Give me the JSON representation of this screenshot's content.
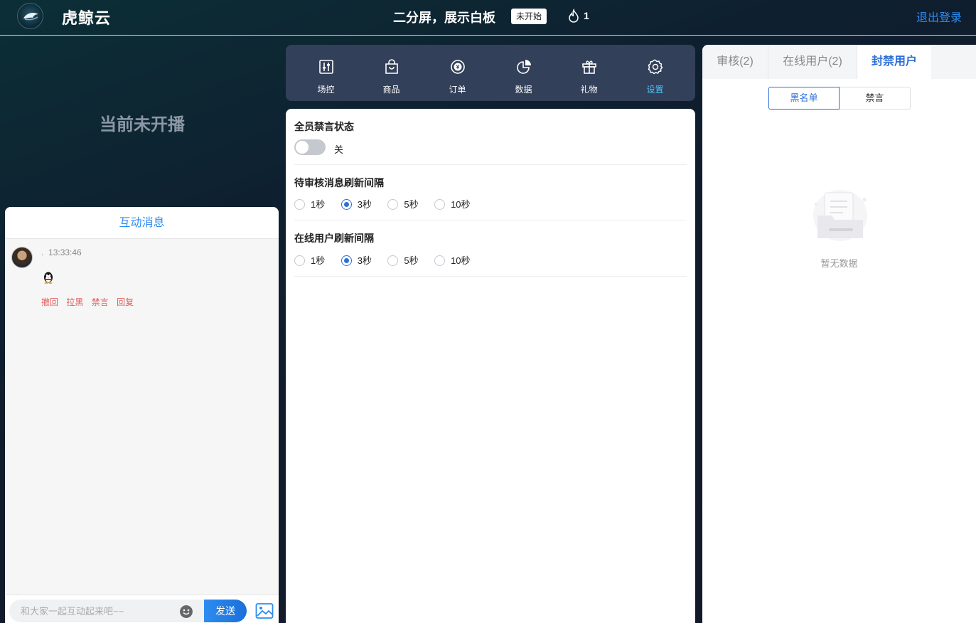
{
  "header": {
    "brand": "虎鲸云",
    "title": "二分屏，展示白板",
    "status": "未开始",
    "viewers": "1",
    "logout": "退出登录"
  },
  "stage": {
    "no_live_text": "当前未开播"
  },
  "chat": {
    "title": "互动消息",
    "messages": [
      {
        "user": ".",
        "time": "13:33:46",
        "content_icon": "penguin-emoji",
        "actions": [
          "撤回",
          "拉黑",
          "禁言",
          "回复"
        ]
      }
    ],
    "input_placeholder": "和大家一起互动起来吧~~",
    "send_label": "发送"
  },
  "toolbar": {
    "items": [
      {
        "label": "场控",
        "icon": "field-control-icon"
      },
      {
        "label": "商品",
        "icon": "shopping-bag-icon"
      },
      {
        "label": "订单",
        "icon": "yuan-coin-icon"
      },
      {
        "label": "数据",
        "icon": "pie-chart-icon"
      },
      {
        "label": "礼物",
        "icon": "gift-icon"
      },
      {
        "label": "设置",
        "icon": "gear-icon",
        "active": true
      }
    ],
    "active_color": "#4fc3f7"
  },
  "settings": {
    "mute_all": {
      "title": "全员禁言状态",
      "state_label": "关",
      "enabled": false
    },
    "review_refresh": {
      "title": "待审核消息刷新间隔",
      "options": [
        "1秒",
        "3秒",
        "5秒",
        "10秒"
      ],
      "selected": "3秒"
    },
    "online_refresh": {
      "title": "在线用户刷新间隔",
      "options": [
        "1秒",
        "3秒",
        "5秒",
        "10秒"
      ],
      "selected": "3秒"
    }
  },
  "right_panel": {
    "tabs": [
      "审核(2)",
      "在线用户(2)",
      "封禁用户"
    ],
    "active_tab": "封禁用户",
    "subtabs": [
      "黑名单",
      "禁言"
    ],
    "active_subtab": "黑名单",
    "empty_text": "暂无数据"
  },
  "colors": {
    "accent": "#2d6fd9",
    "link": "#2d8cf0",
    "danger": "#e35b5b",
    "toolbar_bg": "#33405a"
  }
}
